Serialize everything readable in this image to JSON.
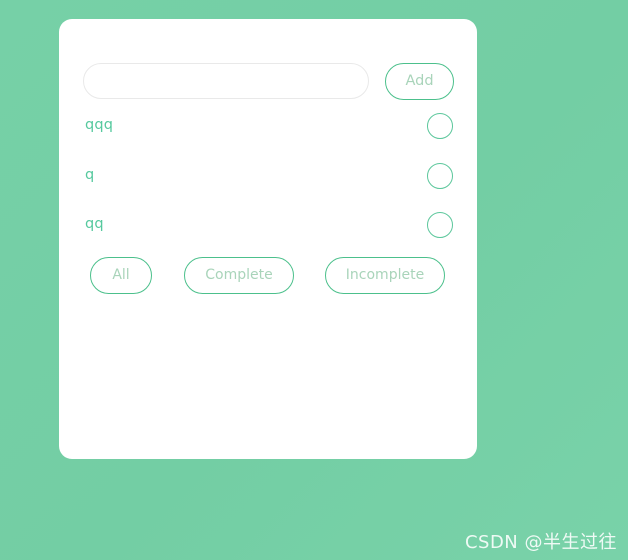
{
  "theme": {
    "background_start": "#76d0a7",
    "background_end": "#79d2a9",
    "card_background": "#ffffff",
    "accent": "#4cc08c",
    "item_text": "#56c99e",
    "button_text": "#a9d4ba",
    "input_border": "#e9e9e9"
  },
  "composer": {
    "input_value": "",
    "input_placeholder": "",
    "add_label": "Add"
  },
  "todos": [
    {
      "label": "qqq",
      "completed": false
    },
    {
      "label": "q",
      "completed": false
    },
    {
      "label": "qq",
      "completed": false
    }
  ],
  "filters": [
    {
      "label": "All"
    },
    {
      "label": "Complete"
    },
    {
      "label": "Incomplete"
    }
  ],
  "watermark": {
    "text": "CSDN @半生过往"
  }
}
